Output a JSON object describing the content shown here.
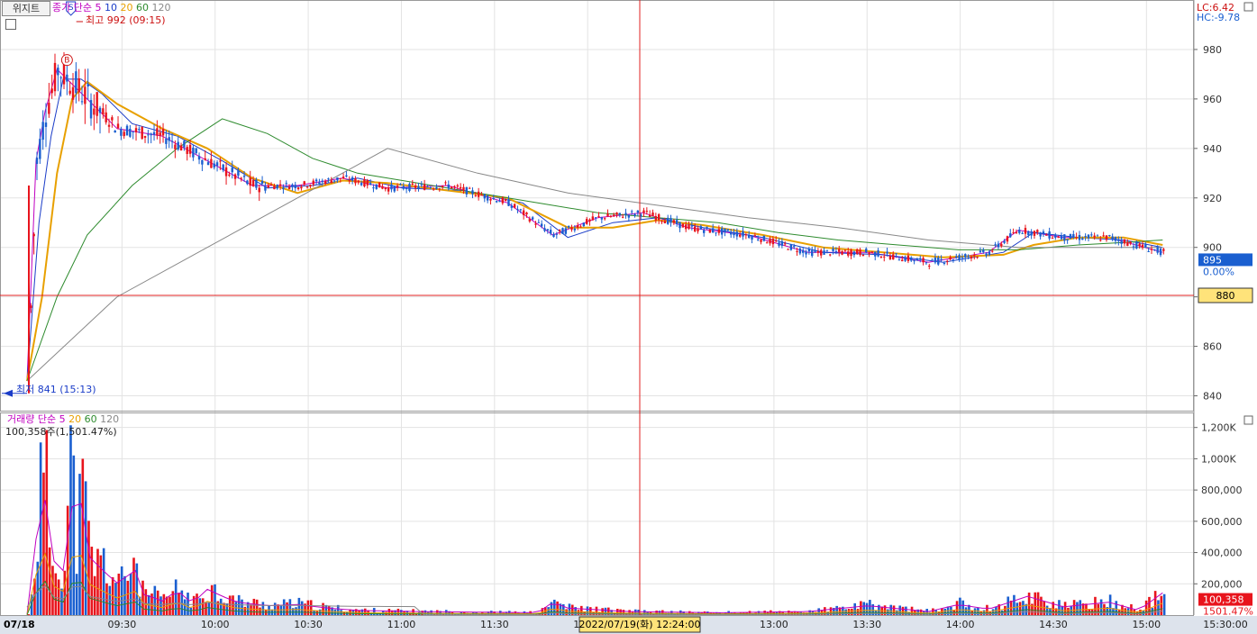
{
  "widget_tab": "위지트",
  "price_legend": {
    "label": "종가 단순",
    "periods": [
      {
        "value": "5",
        "color": "#c000c0"
      },
      {
        "value": "10",
        "color": "#1a3cc8"
      },
      {
        "value": "20",
        "color": "#e8a000"
      },
      {
        "value": "60",
        "color": "#2e8b2e"
      },
      {
        "value": "120",
        "color": "#888888"
      }
    ]
  },
  "high_marker": "최고 992 (09:15)",
  "low_marker": "최저 841 (15:13)",
  "lc_label": "LC:6.42",
  "hc_label": "HC:-9.78",
  "current_price": "895",
  "current_change": "0.00%",
  "crosshair_price": "880",
  "crosshair_time": "2022/07/19(화) 12:24:00",
  "volume_legend": {
    "label": "거래량 단순",
    "periods": [
      {
        "value": "5",
        "color": "#c000c0"
      },
      {
        "value": "20",
        "color": "#e8a000"
      },
      {
        "value": "60",
        "color": "#2e8b2e"
      },
      {
        "value": "120",
        "color": "#888888"
      }
    ]
  },
  "volume_info": "100,358주(1,501.47%)",
  "volume_current": "100,358",
  "volume_ratio": "1501.47%",
  "date_label": "07/18",
  "buy_marker": "B",
  "sell_marker": "S",
  "colors": {
    "up": "#e8141c",
    "down": "#1a5fd0",
    "crosshair": "#e02020",
    "grid": "#e3e3e3"
  },
  "chart_data": [
    {
      "type": "candlestick",
      "y_ticks": [
        840,
        860,
        880,
        900,
        920,
        940,
        960,
        980
      ],
      "ylim": [
        834,
        1000
      ],
      "x_ticks": [
        "09:30",
        "10:00",
        "10:30",
        "11:00",
        "11:30",
        "12:00",
        "13:00",
        "13:30",
        "14:00",
        "14:30",
        "15:00",
        "15:30:00"
      ],
      "high": 992,
      "low": 841,
      "last": 895,
      "series": [
        {
          "name": "5",
          "values": [
            [
              0,
              846
            ],
            [
              3,
              935
            ],
            [
              6,
              955
            ],
            [
              10,
              972
            ],
            [
              15,
              966
            ],
            [
              20,
              960
            ],
            [
              30,
              948
            ],
            [
              45,
              945
            ],
            [
              60,
              935
            ],
            [
              75,
              925
            ],
            [
              90,
              925
            ],
            [
              105,
              928
            ],
            [
              120,
              924
            ],
            [
              140,
              925
            ],
            [
              160,
              918
            ],
            [
              175,
              905
            ],
            [
              190,
              912
            ],
            [
              205,
              914
            ],
            [
              220,
              908
            ],
            [
              240,
              905
            ],
            [
              260,
              898
            ],
            [
              280,
              898
            ],
            [
              300,
              894
            ],
            [
              320,
              898
            ],
            [
              330,
              907
            ],
            [
              345,
              904
            ],
            [
              360,
              904
            ],
            [
              378,
              898
            ]
          ]
        },
        {
          "name": "10",
          "values": [
            [
              0,
              846
            ],
            [
              4,
              910
            ],
            [
              8,
              945
            ],
            [
              12,
              968
            ],
            [
              18,
              968
            ],
            [
              25,
              962
            ],
            [
              35,
              950
            ],
            [
              50,
              945
            ],
            [
              65,
              935
            ],
            [
              80,
              924
            ],
            [
              95,
              925
            ],
            [
              110,
              928
            ],
            [
              125,
              924
            ],
            [
              145,
              923
            ],
            [
              165,
              918
            ],
            [
              180,
              904
            ],
            [
              195,
              910
            ],
            [
              210,
              912
            ],
            [
              225,
              908
            ],
            [
              245,
              904
            ],
            [
              265,
              898
            ],
            [
              285,
              897
            ],
            [
              305,
              894
            ],
            [
              325,
              898
            ],
            [
              335,
              906
            ],
            [
              350,
              904
            ],
            [
              365,
              903
            ],
            [
              378,
              900
            ]
          ]
        },
        {
          "name": "20",
          "values": [
            [
              0,
              846
            ],
            [
              5,
              880
            ],
            [
              10,
              930
            ],
            [
              15,
              960
            ],
            [
              20,
              967
            ],
            [
              30,
              958
            ],
            [
              45,
              948
            ],
            [
              60,
              940
            ],
            [
              75,
              928
            ],
            [
              90,
              922
            ],
            [
              105,
              927
            ],
            [
              120,
              926
            ],
            [
              140,
              923
            ],
            [
              160,
              920
            ],
            [
              180,
              908
            ],
            [
              195,
              908
            ],
            [
              210,
              911
            ],
            [
              225,
              909
            ],
            [
              245,
              905
            ],
            [
              265,
              900
            ],
            [
              285,
              898
            ],
            [
              305,
              896
            ],
            [
              325,
              897
            ],
            [
              335,
              901
            ],
            [
              350,
              904
            ],
            [
              365,
              904
            ],
            [
              378,
              901
            ]
          ]
        },
        {
          "name": "60",
          "values": [
            [
              0,
              846
            ],
            [
              10,
              880
            ],
            [
              20,
              905
            ],
            [
              35,
              925
            ],
            [
              50,
              940
            ],
            [
              65,
              952
            ],
            [
              80,
              946
            ],
            [
              95,
              936
            ],
            [
              110,
              930
            ],
            [
              130,
              926
            ],
            [
              150,
              922
            ],
            [
              170,
              918
            ],
            [
              190,
              914
            ],
            [
              210,
              912
            ],
            [
              230,
              910
            ],
            [
              250,
              906
            ],
            [
              270,
              903
            ],
            [
              290,
              901
            ],
            [
              310,
              899
            ],
            [
              330,
              899
            ],
            [
              350,
              901
            ],
            [
              365,
              902
            ],
            [
              378,
              903
            ]
          ]
        },
        {
          "name": "120",
          "values": [
            [
              0,
              846
            ],
            [
              30,
              880
            ],
            [
              60,
              900
            ],
            [
              90,
              920
            ],
            [
              120,
              940
            ],
            [
              150,
              930
            ],
            [
              180,
              922
            ],
            [
              210,
              917
            ],
            [
              240,
              912
            ],
            [
              270,
              908
            ],
            [
              300,
              903
            ],
            [
              330,
              900
            ],
            [
              378,
              900
            ]
          ]
        }
      ]
    },
    {
      "type": "bar",
      "y_ticks": [
        "200,000",
        "400,000",
        "600,000",
        "800,000",
        "1,000K",
        "1,200K"
      ],
      "ylim": [
        0,
        1250000
      ],
      "last": 100358,
      "series": [
        {
          "name": "거래량",
          "values": [
            [
              0,
              6000
            ],
            [
              2,
              420000
            ],
            [
              3,
              650000
            ],
            [
              4,
              1030000
            ],
            [
              6,
              980000
            ],
            [
              8,
              420000
            ],
            [
              10,
              500000
            ],
            [
              12,
              380000
            ],
            [
              14,
              1200000
            ],
            [
              16,
              650000
            ],
            [
              18,
              950000
            ],
            [
              20,
              580000
            ],
            [
              22,
              400000
            ],
            [
              25,
              420000
            ],
            [
              28,
              300000
            ],
            [
              32,
              250000
            ],
            [
              35,
              480000
            ],
            [
              38,
              180000
            ],
            [
              42,
              150000
            ],
            [
              45,
              120000
            ],
            [
              50,
              210000
            ],
            [
              55,
              100000
            ],
            [
              60,
              220000
            ],
            [
              65,
              160000
            ],
            [
              70,
              110000
            ],
            [
              80,
              80000
            ],
            [
              90,
              90000
            ],
            [
              100,
              60000
            ],
            [
              110,
              40000
            ],
            [
              130,
              30000
            ],
            [
              150,
              25000
            ],
            [
              170,
              20000
            ],
            [
              175,
              110000
            ],
            [
              180,
              60000
            ],
            [
              200,
              30000
            ],
            [
              230,
              20000
            ],
            [
              260,
              30000
            ],
            [
              280,
              80000
            ],
            [
              300,
              30000
            ],
            [
              310,
              90000
            ],
            [
              320,
              50000
            ],
            [
              333,
              160000
            ],
            [
              345,
              70000
            ],
            [
              360,
              110000
            ],
            [
              370,
              40000
            ],
            [
              378,
              190000
            ]
          ]
        }
      ]
    }
  ]
}
